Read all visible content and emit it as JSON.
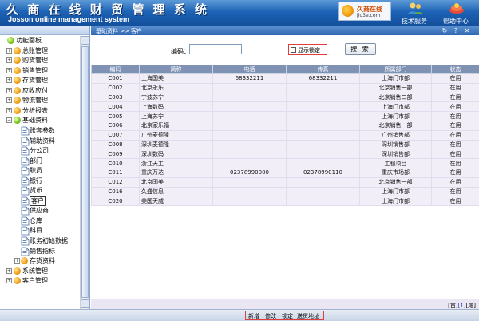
{
  "header": {
    "title": "久 商 在 线 财 贸 管 理 系 统",
    "subtitle": "Josson online management system",
    "brand_name": "久商在线",
    "brand_domain": "jiu3e.com",
    "links": [
      {
        "label": "技术服务",
        "icon": "tech-service-icon"
      },
      {
        "label": "帮助中心",
        "icon": "help-center-icon"
      }
    ]
  },
  "nav": {
    "items": [
      {
        "label": "功能面板",
        "kind": "root"
      },
      {
        "label": "总账管理",
        "kind": "group"
      },
      {
        "label": "购货管理",
        "kind": "group"
      },
      {
        "label": "销售管理",
        "kind": "group"
      },
      {
        "label": "存货管理",
        "kind": "group"
      },
      {
        "label": "应收应付",
        "kind": "group"
      },
      {
        "label": "物流管理",
        "kind": "group"
      },
      {
        "label": "分析报表",
        "kind": "group"
      },
      {
        "label": "基础资料",
        "kind": "open"
      },
      {
        "label": "账套参数",
        "kind": "leaf"
      },
      {
        "label": "辅助资料",
        "kind": "leaf"
      },
      {
        "label": "分公司",
        "kind": "leaf"
      },
      {
        "label": "部门",
        "kind": "leaf"
      },
      {
        "label": "职员",
        "kind": "leaf"
      },
      {
        "label": "银行",
        "kind": "leaf"
      },
      {
        "label": "货币",
        "kind": "leaf"
      },
      {
        "label": "客户",
        "kind": "leaf",
        "selected": true
      },
      {
        "label": "供应商",
        "kind": "leaf"
      },
      {
        "label": "仓库",
        "kind": "leaf"
      },
      {
        "label": "科目",
        "kind": "leaf"
      },
      {
        "label": "账务初始数据",
        "kind": "leaf"
      },
      {
        "label": "销售指标",
        "kind": "leaf"
      },
      {
        "label": "存货资料",
        "kind": "subgroup"
      },
      {
        "label": "系统管理",
        "kind": "group"
      },
      {
        "label": "客户管理",
        "kind": "group"
      }
    ]
  },
  "breadcrumb": "基础资料 >> 客户",
  "tools": {
    "refresh": "↻",
    "help": "?",
    "close": "✕"
  },
  "filter": {
    "code_label": "编码：",
    "code_value": "",
    "show_locked_label": "显示锁定",
    "search_label": "搜 索"
  },
  "table": {
    "columns": [
      "编码",
      "简称",
      "电话",
      "传真",
      "所属部门",
      "状态"
    ],
    "rows": [
      [
        "C001",
        "上海国美",
        "68332211",
        "68332211",
        "上海门市部",
        "在用"
      ],
      [
        "C002",
        "北京永乐",
        "",
        "",
        "北京销售一部",
        "在用"
      ],
      [
        "C003",
        "宁波苏宁",
        "",
        "",
        "北京销售二部",
        "在用"
      ],
      [
        "C004",
        "上海数码",
        "",
        "",
        "上海门市部",
        "在用"
      ],
      [
        "C005",
        "上海苏宁",
        "",
        "",
        "上海门市部",
        "在用"
      ],
      [
        "C006",
        "北京家乐福",
        "",
        "",
        "北京销售一部",
        "在用"
      ],
      [
        "C007",
        "广州麦德隆",
        "",
        "",
        "广州销售部",
        "在用"
      ],
      [
        "C008",
        "深圳麦德隆",
        "",
        "",
        "深圳销售部",
        "在用"
      ],
      [
        "C009",
        "深圳数码",
        "",
        "",
        "深圳销售部",
        "在用"
      ],
      [
        "C010",
        "浙江天工",
        "",
        "",
        "工程项目",
        "在用"
      ],
      [
        "C011",
        "重庆万达",
        "02378990000",
        "02378990110",
        "重庆市场部",
        "在用"
      ],
      [
        "C012",
        "北京国美",
        "",
        "",
        "北京销售一部",
        "在用"
      ],
      [
        "C016",
        "久盛信息",
        "",
        "",
        "上海门市部",
        "在用"
      ],
      [
        "C020",
        "美国天威",
        "",
        "",
        "上海门市部",
        "在用"
      ]
    ]
  },
  "pager": {
    "first": "[首]",
    "current": "[1]",
    "last": "[尾]"
  },
  "actions": [
    "新增",
    "修改",
    "锁定",
    "送货地址"
  ],
  "colors": {
    "header": "#1a5eb0",
    "grid_header": "#7f92b4",
    "grid_row": "#f2eef8",
    "highlight_box": "#e23b3b"
  }
}
